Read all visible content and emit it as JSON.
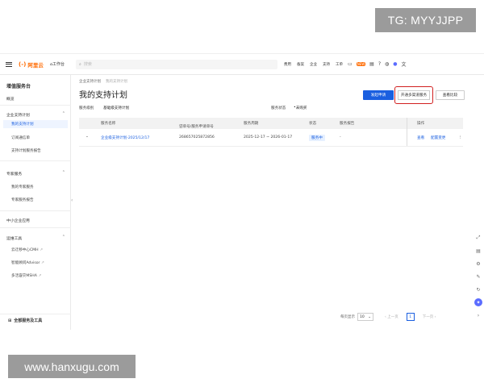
{
  "watermarks": {
    "top": "TG: MYYJJPP",
    "bottom": "www.hanxugu.com"
  },
  "topbar": {
    "logo_text": "阿里云",
    "logo_mark": "(-)",
    "workbench": "工作台",
    "search_placeholder": "搜索",
    "links": [
      "费用",
      "备案",
      "企业",
      "支持",
      "工单"
    ],
    "badge": "NEW"
  },
  "sidebar": {
    "title": "增值服务台",
    "overview": "概览",
    "sections": [
      {
        "label": "企业支持计划",
        "items": [
          "我的支持计划",
          "订阅通信单",
          "支持计划服务报告"
        ]
      },
      {
        "label": "专家服务",
        "items": [
          "我的专家服务",
          "专家服务报告"
        ]
      },
      {
        "label": "中小企业应用",
        "items": []
      },
      {
        "label": "运维工具",
        "items": [
          "云迁移中心CMH",
          "智能顾问Advisor",
          "多活容灾MSHA"
        ]
      }
    ],
    "footer": "全部服务及工具"
  },
  "main": {
    "breadcrumbs": [
      "企业支持计划",
      "我的支持计划"
    ],
    "title": "我的支持计划",
    "buttons": {
      "primary": "发起申请",
      "open_multi": "开通多渠道服务",
      "compare": "查看比较"
    },
    "filters": {
      "level_label": "服务级别",
      "level_value": "基础级支持计划",
      "status_label": "服务状态",
      "status_value": "未购买"
    },
    "table": {
      "headers": [
        "服务名称",
        "订单号/服务申请单号",
        "服务周期",
        "状态",
        "服务报告",
        "操作"
      ],
      "rows": [
        {
          "name": "企业级支持计划-2025/12/17",
          "order": "268657025872856",
          "period": "2025-12-17 ~ 2026-01-17",
          "status": "服务中",
          "report": "-",
          "action_view": "查看",
          "action_change": "配置变更"
        }
      ]
    },
    "pager": {
      "page_size_label": "每页显示",
      "page_size": "10",
      "prev": "上一页",
      "current": "1",
      "next": "下一页"
    }
  }
}
